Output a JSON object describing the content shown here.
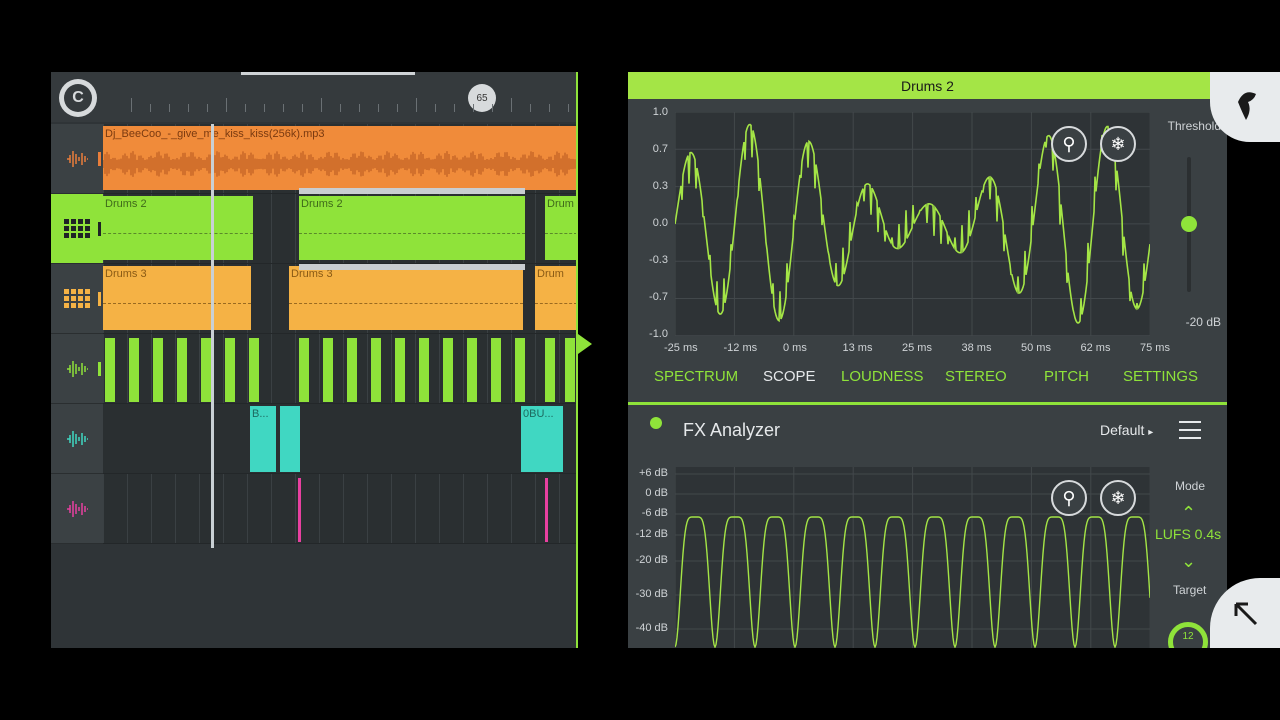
{
  "playlist": {
    "bar_marker": "65",
    "tracks": [
      {
        "icon": "audio-wave-icon",
        "color": "#e97e3b"
      },
      {
        "icon": "pattern-grid-icon",
        "color": "#8fe33a"
      },
      {
        "icon": "pattern-grid-icon",
        "color": "#f5b245"
      },
      {
        "icon": "audio-wave-icon",
        "color": "#8fe33a"
      },
      {
        "icon": "audio-wave-icon",
        "color": "#40d7c2"
      },
      {
        "icon": "audio-wave-icon",
        "color": "#e840a0"
      }
    ],
    "clips": {
      "audio_name": "Dj_BeeCoo_-_give_me_kiss_kiss(256k).mp3",
      "drums2_a": "Drums 2",
      "drums2_b": "Drums 2",
      "drums2_c": "Drum",
      "drums3_a": "Drums 3",
      "drums3_b": "Drums 3",
      "drums3_c": "Drum",
      "teal_a": "B...",
      "teal_b": "0BU..."
    }
  },
  "scope": {
    "title": "Drums 2",
    "y_ticks": [
      "1.0",
      "0.7",
      "0.3",
      "0.0",
      "-0.3",
      "-0.7",
      "-1.0"
    ],
    "x_ticks": [
      "-25 ms",
      "-12 ms",
      "0 ms",
      "13 ms",
      "25 ms",
      "38 ms",
      "50 ms",
      "62 ms",
      "75 ms"
    ],
    "threshold_label": "Threshold",
    "threshold_min": "-20 dB",
    "tabs": [
      "SPECTRUM",
      "SCOPE",
      "LOUDNESS",
      "STEREO",
      "PITCH",
      "SETTINGS"
    ],
    "selected_tab": "SCOPE"
  },
  "fx": {
    "title": "FX Analyzer",
    "preset": "Default",
    "y_ticks": [
      "+6 dB",
      "0 dB",
      "-6 dB",
      "-12 dB",
      "-20 dB",
      "-30 dB",
      "-40 dB"
    ],
    "mode_label": "Mode",
    "mode_value": "LUFS 0.4s",
    "target_label": "Target",
    "target_value": "12"
  },
  "colors": {
    "accent": "#8fe33a",
    "audio_clip": "#f08b3a",
    "drums3_clip": "#f5b245",
    "teal_clip": "#40d7c2"
  }
}
